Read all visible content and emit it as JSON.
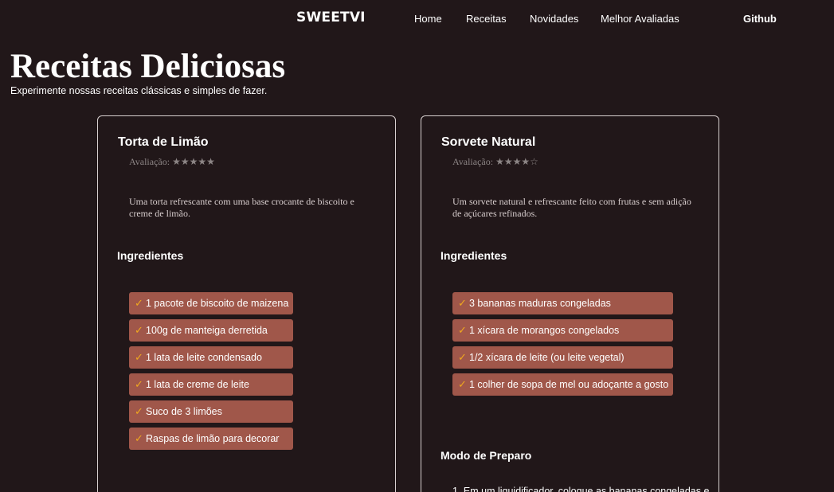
{
  "brand": "SWEETVI",
  "nav": {
    "home": "Home",
    "receitas": "Receitas",
    "novidades": "Novidades",
    "melhor": "Melhor Avaliadas",
    "github": "Github"
  },
  "hero": {
    "title": "Receitas Deliciosas",
    "subtitle": "Experimente nossas receitas clássicas e simples de fazer."
  },
  "colors": {
    "background": "#211719",
    "ingredient_bg": "#a0574a",
    "check": "#f0a81e"
  },
  "icons": {
    "check": "check-icon"
  },
  "cards": [
    {
      "title": "Torta de Limão",
      "rating": "Avaliação: ★★★★★",
      "rating_value": 5,
      "description": "Uma torta refrescante com uma base crocante de biscoito e creme de limão.",
      "ingredients_heading": "Ingredientes",
      "ingredients": [
        "1 pacote de biscoito de maizena",
        "100g de manteiga derretida",
        "1 lata de leite condensado",
        "1 lata de creme de leite",
        "Suco de 3 limões",
        "Raspas de limão para decorar"
      ]
    },
    {
      "title": "Sorvete Natural",
      "rating": "Avaliação: ★★★★☆",
      "rating_value": 4,
      "description": "Um sorvete natural e refrescante feito com frutas e sem adição de açúcares refinados.",
      "ingredients_heading": "Ingredientes",
      "ingredients": [
        "3 bananas maduras congeladas",
        "1 xícara de morangos congelados",
        "1/2 xícara de leite (ou leite vegetal)",
        "1 colher de sopa de mel ou adoçante a gosto"
      ],
      "method_heading": "Modo de Preparo",
      "steps": [
        "1. Em um liquidificador, coloque as bananas congeladas e"
      ]
    }
  ]
}
